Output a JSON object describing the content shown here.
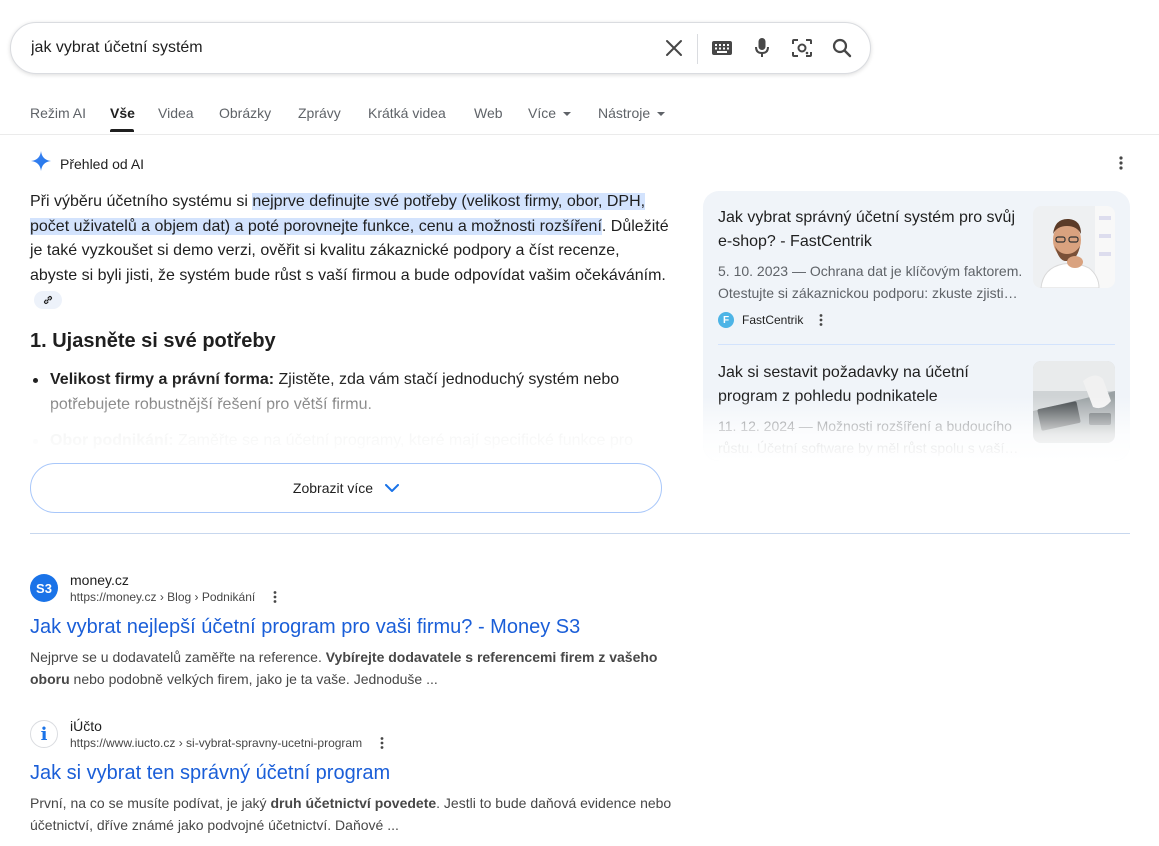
{
  "search": {
    "query": "jak vybrat účetní systém"
  },
  "tabs": [
    {
      "label": "Režim AI"
    },
    {
      "label": "Vše"
    },
    {
      "label": "Videa"
    },
    {
      "label": "Obrázky"
    },
    {
      "label": "Zprávy"
    },
    {
      "label": "Krátká videa"
    },
    {
      "label": "Web"
    },
    {
      "label": "Více"
    },
    {
      "label": "Nástroje"
    }
  ],
  "ai_overview": {
    "title": "Přehled od AI",
    "intro_start": "Při výběru účetního systému si ",
    "intro_highlight": "nejprve definujte své potřeby (velikost firmy, obor, DPH, počet uživatelů a objem dat) a poté porovnejte funkce, cenu a možnosti rozšíření",
    "intro_end": ". Důležité je také vyzkoušet si demo verzi, ověřit si kvalitu zákaznické podpory a číst recenze, abyste si byli jisti, že systém bude růst s vaší firmou a bude odpovídat vašim očekáváním.",
    "heading": "1. Ujasněte si své potřeby",
    "items": [
      {
        "bold": "Velikost firmy a právní forma:",
        "text": " Zjistěte, zda vám stačí jednoduchý systém nebo",
        "text2": "potřebujete robustnější řešení pro větší firmu."
      },
      {
        "bold": "Obor podnikání:",
        "text": " Zaměřte se na účetní programy, které mají specifické funkce pro"
      }
    ],
    "show_more": "Zobrazit více"
  },
  "sources": [
    {
      "title": "Jak vybrat správný účetní systém pro svůj e-shop? - FastCentrik",
      "snippet": "5. 10. 2023 — Ochrana dat je klíčovým faktorem. Otestujte si zákaznickou podporu: zkuste zjisti…",
      "site": "FastCentrik",
      "logo": "F"
    },
    {
      "title": "Jak si sestavit požadavky na účetní program z pohledu podnikatele",
      "snippet": "11. 12. 2024 — Možnosti rozšíření a budoucího růstu. Účetní software by měl růst spolu s vaší…"
    }
  ],
  "results": [
    {
      "site": "money.cz",
      "url": "https://money.cz › Blog › Podnikání",
      "favicon_text": "S3",
      "favicon_color": "#1a73e8",
      "title": "Jak vybrat nejlepší účetní program pro vaši firmu? - Money S3",
      "snippet_a": "Nejprve se u dodavatelů zaměřte na reference. ",
      "snippet_bold": "Vybírejte dodavatele s referencemi firem z vašeho oboru",
      "snippet_b": " nebo podobně velkých firem, jako je ta vaše. Jednoduše ..."
    },
    {
      "site": "iÚčto",
      "url": "https://www.iucto.cz › si-vybrat-spravny-ucetni-program",
      "favicon_text": "i",
      "favicon_color": "#1a73e8",
      "title": "Jak si vybrat ten správný účetní program",
      "snippet_a": "První, na co se musíte podívat, je jaký ",
      "snippet_bold": "druh účetnictví povedete",
      "snippet_b": ". Jestli to bude daňová evidence nebo účetnictví, dříve známé jako podvojné účetnictví. Daňové ..."
    }
  ]
}
